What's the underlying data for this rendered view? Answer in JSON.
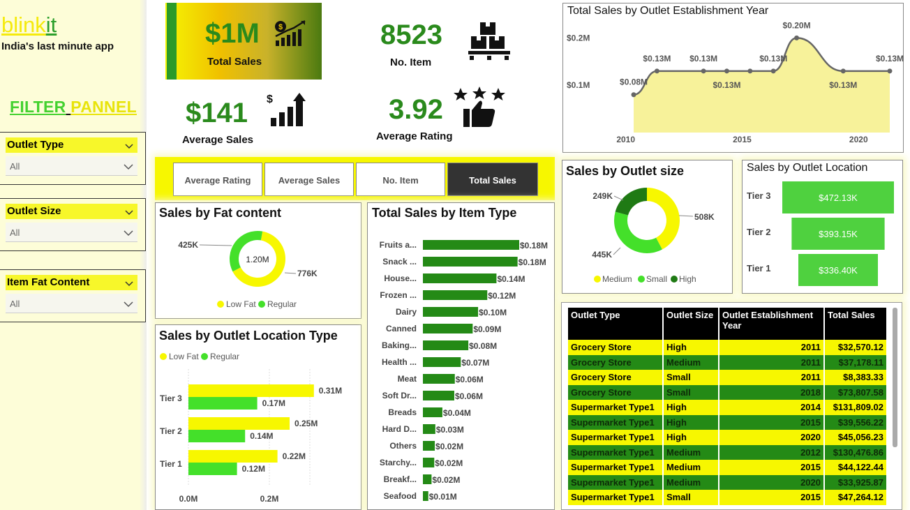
{
  "app": {
    "logo_main": "blink",
    "logo_accent": "it",
    "tagline": "India's last minute app",
    "filter_title_a": "FILTER",
    "filter_title_b": "PANNEL"
  },
  "filters": [
    {
      "label": "Outlet Type",
      "value": "All"
    },
    {
      "label": "Outlet Size",
      "value": "All"
    },
    {
      "label": "Item Fat Content",
      "value": "All"
    }
  ],
  "kpis": {
    "total_sales": {
      "value": "$1M",
      "label": "Total Sales",
      "icon": "money-growth-icon"
    },
    "no_item": {
      "value": "8523",
      "label": "No. Item",
      "icon": "boxes-icon"
    },
    "avg_sales": {
      "value": "$141",
      "label": "Average Sales",
      "icon": "bar-growth-icon"
    },
    "avg_rating": {
      "value": "3.92",
      "label": "Average Rating",
      "icon": "thumbs-stars-icon"
    }
  },
  "metric_selector": {
    "buttons": [
      "Average Rating",
      "Average Sales",
      "No. Item",
      "Total Sales"
    ],
    "active": "Total Sales"
  },
  "colors": {
    "yellow": "#f7f700",
    "green": "#248a16",
    "bright_green": "#44e02a",
    "dark_green": "#1f7a14",
    "area_fill": "#f7f29a"
  },
  "chart_data": [
    {
      "id": "fat",
      "type": "pie",
      "title": "Sales by Fat content",
      "center_label": "1.20M",
      "labels": [
        "Low Fat",
        "Regular"
      ],
      "values": [
        776,
        425
      ],
      "data_labels": [
        "776K",
        "425K"
      ],
      "colors": [
        "#f7f700",
        "#44e02a"
      ],
      "legend_placement": "bottom"
    },
    {
      "id": "loc",
      "type": "bar",
      "orientation": "horizontal",
      "title": "Sales by Outlet Location Type",
      "categories": [
        "Tier 3",
        "Tier 2",
        "Tier 1"
      ],
      "series": [
        {
          "name": "Low Fat",
          "values": [
            0.31,
            0.25,
            0.22
          ],
          "labels": [
            "0.31M",
            "0.25M",
            "0.22M"
          ]
        },
        {
          "name": "Regular",
          "values": [
            0.17,
            0.14,
            0.12
          ],
          "labels": [
            "0.17M",
            "0.14M",
            "0.12M"
          ]
        }
      ],
      "xticks": [
        "0.0M",
        "0.2M"
      ],
      "xtick_values": [
        0,
        0.2
      ],
      "xlim": [
        0,
        0.4
      ],
      "legend_placement": "top-left",
      "grid": true
    },
    {
      "id": "item",
      "type": "bar",
      "orientation": "horizontal",
      "title": "Total Sales by Item Type",
      "categories": [
        "Fruits a...",
        "Snack ...",
        "House...",
        "Frozen ...",
        "Dairy",
        "Canned",
        "Baking...",
        "Health ...",
        "Meat",
        "Soft Dr...",
        "Breads",
        "Hard D...",
        "Others",
        "Starchy...",
        "Breakf...",
        "Seafood"
      ],
      "values": [
        0.178,
        0.175,
        0.136,
        0.119,
        0.102,
        0.092,
        0.084,
        0.07,
        0.059,
        0.058,
        0.036,
        0.023,
        0.022,
        0.021,
        0.016,
        0.01
      ],
      "labels": [
        "$0.18M",
        "$0.18M",
        "$0.14M",
        "$0.12M",
        "$0.10M",
        "$0.09M",
        "$0.08M",
        "$0.07M",
        "$0.06M",
        "$0.06M",
        "$0.04M",
        "$0.03M",
        "$0.02M",
        "$0.02M",
        "$0.02M",
        "$0.01M"
      ],
      "xlim": [
        0,
        0.178
      ]
    },
    {
      "id": "year",
      "type": "area",
      "title": "Total Sales by Outlet Establishment Year",
      "x": [
        2011,
        2012,
        2014,
        2015,
        2016,
        2017,
        2018,
        2020,
        2022
      ],
      "values": [
        0.08,
        0.13,
        0.13,
        0.13,
        0.13,
        0.13,
        0.2,
        0.13,
        0.13
      ],
      "labels": [
        "$0.08M",
        "$0.13M",
        "$0.13M",
        "$0.13M",
        "",
        "$0.13M",
        "$0.20M",
        "$0.13M",
        "$0.13M"
      ],
      "xticks": [
        "2010",
        "2015",
        "2020"
      ],
      "xtick_values": [
        2010,
        2015,
        2020
      ],
      "yticks": [
        "$0.1M",
        "$0.2M"
      ],
      "ytick_values": [
        0.1,
        0.2
      ],
      "xlim": [
        2009.2,
        2022
      ],
      "ylim": [
        0,
        0.23
      ]
    },
    {
      "id": "size",
      "type": "pie",
      "title": "Sales by Outlet size",
      "labels": [
        "Medium",
        "Small",
        "High"
      ],
      "values": [
        508,
        445,
        249
      ],
      "data_labels": [
        "508K",
        "445K",
        "249K"
      ],
      "colors": [
        "#f7f700",
        "#44e02a",
        "#1f7a14"
      ],
      "legend_placement": "bottom"
    },
    {
      "id": "tier",
      "type": "bar",
      "title": "Sales by Outlet Location",
      "categories": [
        "Tier 3",
        "Tier 2",
        "Tier 1"
      ],
      "values": [
        472.13,
        393.15,
        336.4
      ],
      "labels": [
        "$472.13K",
        "$393.15K",
        "$336.40K"
      ],
      "color": "#4fd13f"
    },
    {
      "id": "table",
      "type": "table",
      "columns": [
        "Outlet Type",
        "Outlet Size",
        "Outlet Establishment Year",
        "Total Sales"
      ],
      "rows": [
        [
          "Grocery Store",
          "High",
          "2011",
          "$32,570.12"
        ],
        [
          "Grocery Store",
          "Medium",
          "2011",
          "$37,178.11"
        ],
        [
          "Grocery Store",
          "Small",
          "2011",
          "$8,383.33"
        ],
        [
          "Grocery Store",
          "Small",
          "2018",
          "$73,807.58"
        ],
        [
          "Supermarket Type1",
          "High",
          "2014",
          "$131,809.02"
        ],
        [
          "Supermarket Type1",
          "High",
          "2015",
          "$39,556.22"
        ],
        [
          "Supermarket Type1",
          "High",
          "2020",
          "$45,056.23"
        ],
        [
          "Supermarket Type1",
          "Medium",
          "2012",
          "$130,476.86"
        ],
        [
          "Supermarket Type1",
          "Medium",
          "2015",
          "$44,122.44"
        ],
        [
          "Supermarket Type1",
          "Medium",
          "2020",
          "$33,925.87"
        ],
        [
          "Supermarket Type1",
          "Small",
          "2015",
          "$47,264.12"
        ]
      ]
    }
  ]
}
